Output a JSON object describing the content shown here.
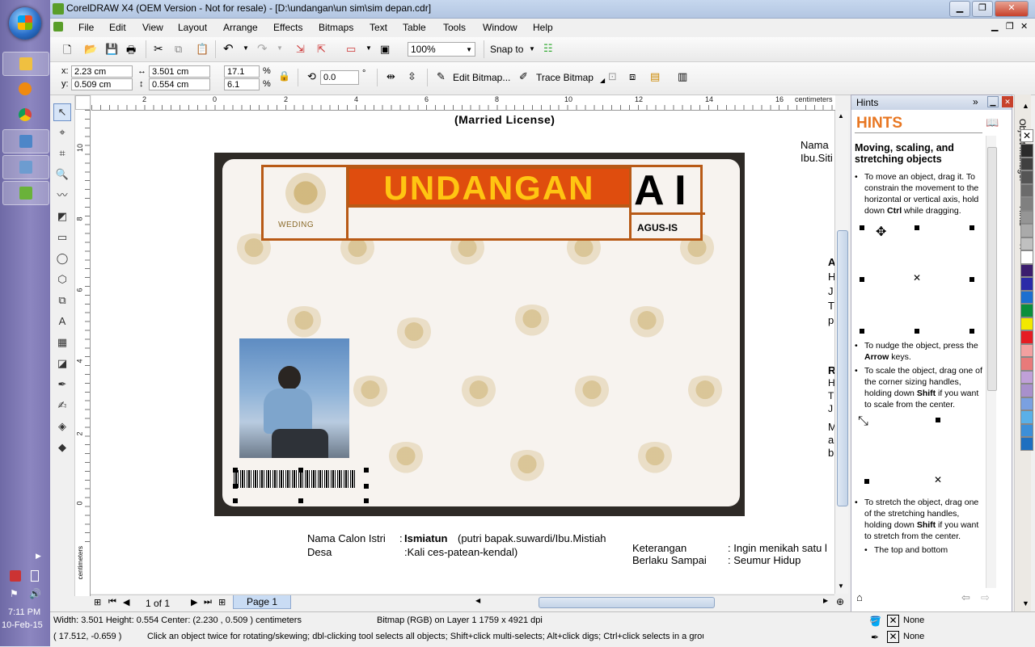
{
  "window": {
    "title": "CorelDRAW X4 (OEM Version - Not for resale) - [D:\\undangan\\un sim\\sim depan.cdr]"
  },
  "menu": [
    "File",
    "Edit",
    "View",
    "Layout",
    "Arrange",
    "Effects",
    "Bitmaps",
    "Text",
    "Table",
    "Tools",
    "Window",
    "Help"
  ],
  "toolbar": {
    "zoom": "100%",
    "snap": "Snap to"
  },
  "property_bar": {
    "x": "2.23 cm",
    "y": "0.509 cm",
    "w": "3.501 cm",
    "h": "0.554 cm",
    "scale_x": "17.1",
    "scale_y": "6.1",
    "pct": "%",
    "angle": "0.0",
    "deg": "°",
    "edit_bitmap": "Edit Bitmap...",
    "trace_bitmap": "Trace Bitmap",
    "x_lbl": "x:",
    "y_lbl": "y:"
  },
  "ruler": {
    "unit": "centimeters",
    "h_ticks": [
      "2",
      "0",
      "2",
      "4",
      "6",
      "8",
      "10",
      "12",
      "14",
      "16"
    ],
    "v_ticks": [
      "10",
      "8",
      "6",
      "4",
      "2",
      "0"
    ],
    "v_unit": "centimeters"
  },
  "canvas": {
    "married": "(Married License)",
    "undangan": "UNDANGAN",
    "ai": "A I",
    "agus": "AGUS-IS",
    "wedding": "WEDING",
    "nama_istri_lbl": "Nama Calon Istri",
    "nama_istri_colon": ":",
    "nama_istri_val": "Ismiatun",
    "nama_istri_rest": "(putri bapak.suwardi/Ibu.Mistiah",
    "desa_lbl": "Desa",
    "desa_val": ":Kali ces-patean-kendal)",
    "ket_lbl": "Keterangan",
    "ket_val": ": Ingin menikah satu l",
    "berlaku_lbl": "Berlaku Sampai",
    "berlaku_val": ": Seumur Hidup",
    "right_nama": "Nama",
    "right_ibu": "Ibu.Siti",
    "right_frag": [
      "A",
      "H",
      "J",
      "T",
      "p",
      "R",
      "H",
      "T",
      "J",
      "M",
      "a",
      "b"
    ]
  },
  "pages": {
    "count": "1 of 1",
    "tab": "Page 1"
  },
  "hints": {
    "docker_title": "Hints",
    "heading": "HINTS",
    "subheading": "Moving, scaling, and stretching objects",
    "b1_pre": "To move an object, drag it. To constrain the movement to the horizontal or vertical axis, hold down ",
    "b1_key": "Ctrl",
    "b1_post": " while dragging.",
    "b2_pre": "To nudge the object, press the ",
    "b2_key": "Arrow",
    "b2_post": " keys.",
    "b3_pre": "To scale the object, drag one of the corner sizing handles, holding down ",
    "b3_key": "Shift",
    "b3_post": " if you want to scale from the center.",
    "b4_pre": "To stretch the object, drag one of the stretching handles, holding down ",
    "b4_key": "Shift",
    "b4_post": " if you want to stretch from the center.",
    "b5": "The top and bottom"
  },
  "docker_tabs": [
    "Object Manager",
    "Hints"
  ],
  "status": {
    "dims": "Width: 3.501  Height: 0.554  Center: (2.230 , 0.509 )  centimeters",
    "object": "Bitmap (RGB) on Layer 1 1759 x 4921 dpi",
    "coords": "( 17.512, -0.659 )",
    "hint": "Click an object twice for rotating/skewing; dbl-clicking tool selects all objects; Shift+click multi-selects; Alt+click digs; Ctrl+click selects in a group",
    "fill": "None",
    "outline": "None"
  },
  "taskbar": {
    "time": "7:11 PM",
    "date": "10-Feb-15"
  },
  "palette": [
    "#2b2b2b",
    "#404040",
    "#555555",
    "#6b6b6b",
    "#808080",
    "#959595",
    "#aaaaaa",
    "#c0c0c0",
    "#ffffff",
    "#3b1d6e",
    "#2b2aa8",
    "#1c6fd0",
    "#0a8f3c",
    "#f2e800",
    "#e51c23",
    "#f3a0a0",
    "#e87a7a",
    "#c0a0d8",
    "#a890cc",
    "#7aa0e0",
    "#5ab0e8",
    "#3d8fd8",
    "#1e6fc0"
  ]
}
